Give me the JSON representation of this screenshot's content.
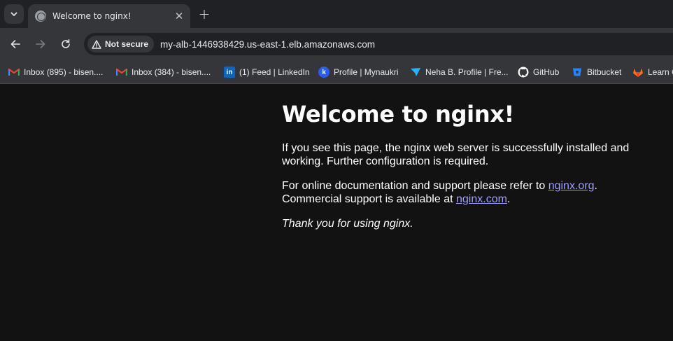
{
  "tab": {
    "title": "Welcome to nginx!",
    "close_glyph": "✕",
    "new_tab_glyph": "+"
  },
  "address_bar": {
    "security_label": "Not secure",
    "url": "my-alb-1446938429.us-east-1.elb.amazonaws.com"
  },
  "bookmarks": [
    {
      "label": "Inbox (895) - bisen....",
      "icon": "gmail-icon"
    },
    {
      "label": "Inbox (384) - bisen....",
      "icon": "gmail-icon"
    },
    {
      "label": "(1) Feed | LinkedIn",
      "icon": "linkedin-icon"
    },
    {
      "label": "Profile | Mynaukri",
      "icon": "naukri-icon"
    },
    {
      "label": "Neha B. Profile | Fre...",
      "icon": "freelancer-icon"
    },
    {
      "label": "GitHub",
      "icon": "github-icon"
    },
    {
      "label": "Bitbucket",
      "icon": "bitbucket-icon"
    },
    {
      "label": "Learn G",
      "icon": "gitlab-icon"
    }
  ],
  "page": {
    "heading": "Welcome to nginx!",
    "para1": "If you see this page, the nginx web server is successfully installed and working. Further configuration is required.",
    "para2_prefix": "For online documentation and support please refer to ",
    "link_org": "nginx.org",
    "para2_mid": ".",
    "para2_line2": "Commercial support is available at ",
    "link_com": "nginx.com",
    "para2_end": ".",
    "thanks": "Thank you for using nginx."
  },
  "colors": {
    "link": "#9e9eff",
    "background": "#121212",
    "chrome": "#35363a"
  }
}
